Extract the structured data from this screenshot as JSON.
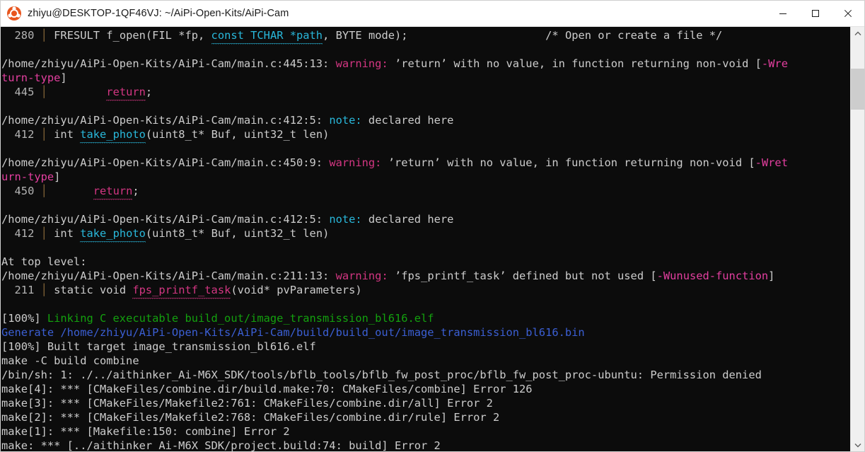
{
  "window": {
    "title": "zhiyu@DESKTOP-1QF46VJ: ~/AiPi-Open-Kits/AiPi-Cam",
    "app_icon": "ubuntu-icon",
    "minimize_label": "—",
    "maximize_label": "□",
    "close_label": "✕"
  },
  "colors": {
    "background": "#0c0c0c",
    "foreground": "#cccccc",
    "magenta": "#d33682",
    "cyan": "#29b8db",
    "green": "#13a10e",
    "blue": "#3b5fd4",
    "gutter": "#8a6a3a",
    "titlebar_bg": "#ffffff",
    "scrollbar_bg": "#f0f0f0",
    "scrollbar_thumb": "#cdcdcd"
  },
  "scrollbar": {
    "up_arrow": "chevron-up-icon",
    "down_arrow": "chevron-down-icon",
    "thumb": "scrollbar-thumb"
  },
  "terminal": {
    "lines": [
      {
        "id": "line-280",
        "segments": [
          {
            "text": "  280 ",
            "color": "dim"
          },
          {
            "text": "│",
            "color": "gutter"
          },
          {
            "text": " FRESULT f_open(FIL *fp, ",
            "color": "def"
          },
          {
            "text": "const TCHAR *path",
            "color": "cyan",
            "squiggle": "cyan"
          },
          {
            "text": ", BYTE mode);",
            "color": "def"
          },
          {
            "text": "                     ",
            "color": "def"
          },
          {
            "text": "/* Open or create a file */",
            "color": "def"
          }
        ]
      },
      {
        "id": "blank-1",
        "segments": []
      },
      {
        "id": "warn-445",
        "segments": [
          {
            "text": "/home/zhiyu/AiPi-Open-Kits/AiPi-Cam/main.c:445:13: ",
            "color": "def"
          },
          {
            "text": "warning: ",
            "color": "mag"
          },
          {
            "text": "’return’ with no value, in function returning non-void [",
            "color": "def"
          },
          {
            "text": "-Wre",
            "color": "magb"
          }
        ]
      },
      {
        "id": "warn-445-wrap",
        "segments": [
          {
            "text": "turn-type",
            "color": "magb"
          },
          {
            "text": "]",
            "color": "def"
          }
        ]
      },
      {
        "id": "line-445",
        "segments": [
          {
            "text": "  445 ",
            "color": "dim"
          },
          {
            "text": "│",
            "color": "gutter"
          },
          {
            "text": "         ",
            "color": "def"
          },
          {
            "text": "return",
            "color": "mag",
            "squiggle": "mag"
          },
          {
            "text": ";",
            "color": "def"
          }
        ]
      },
      {
        "id": "blank-2",
        "segments": []
      },
      {
        "id": "note-412-a",
        "segments": [
          {
            "text": "/home/zhiyu/AiPi-Open-Kits/AiPi-Cam/main.c:412:5: ",
            "color": "def"
          },
          {
            "text": "note: ",
            "color": "cyan"
          },
          {
            "text": "declared here",
            "color": "def"
          }
        ]
      },
      {
        "id": "line-412-a",
        "segments": [
          {
            "text": "  412 ",
            "color": "dim"
          },
          {
            "text": "│",
            "color": "gutter"
          },
          {
            "text": " int ",
            "color": "def"
          },
          {
            "text": "take_photo",
            "color": "cyan",
            "squiggle": "cyan"
          },
          {
            "text": "(uint8_t* Buf, uint32_t len)",
            "color": "def"
          }
        ]
      },
      {
        "id": "blank-3",
        "segments": []
      },
      {
        "id": "warn-450",
        "segments": [
          {
            "text": "/home/zhiyu/AiPi-Open-Kits/AiPi-Cam/main.c:450:9: ",
            "color": "def"
          },
          {
            "text": "warning: ",
            "color": "mag"
          },
          {
            "text": "’return’ with no value, in function returning non-void [",
            "color": "def"
          },
          {
            "text": "-Wret",
            "color": "magb"
          }
        ]
      },
      {
        "id": "warn-450-wrap",
        "segments": [
          {
            "text": "urn-type",
            "color": "magb"
          },
          {
            "text": "]",
            "color": "def"
          }
        ]
      },
      {
        "id": "line-450",
        "segments": [
          {
            "text": "  450 ",
            "color": "dim"
          },
          {
            "text": "│",
            "color": "gutter"
          },
          {
            "text": "       ",
            "color": "def"
          },
          {
            "text": "return",
            "color": "mag",
            "squiggle": "mag"
          },
          {
            "text": ";",
            "color": "def"
          }
        ]
      },
      {
        "id": "blank-4",
        "segments": []
      },
      {
        "id": "note-412-b",
        "segments": [
          {
            "text": "/home/zhiyu/AiPi-Open-Kits/AiPi-Cam/main.c:412:5: ",
            "color": "def"
          },
          {
            "text": "note: ",
            "color": "cyan"
          },
          {
            "text": "declared here",
            "color": "def"
          }
        ]
      },
      {
        "id": "line-412-b",
        "segments": [
          {
            "text": "  412 ",
            "color": "dim"
          },
          {
            "text": "│",
            "color": "gutter"
          },
          {
            "text": " int ",
            "color": "def"
          },
          {
            "text": "take_photo",
            "color": "cyan",
            "squiggle": "cyan"
          },
          {
            "text": "(uint8_t* Buf, uint32_t len)",
            "color": "def"
          }
        ]
      },
      {
        "id": "blank-5",
        "segments": []
      },
      {
        "id": "at-top-level",
        "segments": [
          {
            "text": "At top level:",
            "color": "def"
          }
        ]
      },
      {
        "id": "warn-211",
        "segments": [
          {
            "text": "/home/zhiyu/AiPi-Open-Kits/AiPi-Cam/main.c:211:13: ",
            "color": "def"
          },
          {
            "text": "warning: ",
            "color": "mag"
          },
          {
            "text": "’fps_printf_task’ defined but not used [",
            "color": "def"
          },
          {
            "text": "-Wunused-function",
            "color": "magb"
          },
          {
            "text": "]",
            "color": "def"
          }
        ]
      },
      {
        "id": "line-211",
        "segments": [
          {
            "text": "  211 ",
            "color": "dim"
          },
          {
            "text": "│",
            "color": "gutter"
          },
          {
            "text": " static void ",
            "color": "def"
          },
          {
            "text": "fps_printf_task",
            "color": "mag",
            "squiggle": "mag"
          },
          {
            "text": "(void* pvParameters)",
            "color": "def"
          }
        ]
      },
      {
        "id": "blank-6",
        "segments": []
      },
      {
        "id": "link-100",
        "segments": [
          {
            "text": "[100%] ",
            "color": "def"
          },
          {
            "text": "Linking C executable build_out/image_transmission_bl616.elf",
            "color": "green"
          }
        ]
      },
      {
        "id": "generate-bin",
        "segments": [
          {
            "text": "Generate /home/zhiyu/AiPi-Open-Kits/AiPi-Cam/build/build_out/image_transmission_bl616.bin",
            "color": "blue"
          }
        ]
      },
      {
        "id": "built-target",
        "segments": [
          {
            "text": "[100%] Built target image_transmission_bl616.elf",
            "color": "def"
          }
        ]
      },
      {
        "id": "make-c-build-combine",
        "segments": [
          {
            "text": "make -C build combine",
            "color": "def"
          }
        ]
      },
      {
        "id": "permission-denied",
        "segments": [
          {
            "text": "/bin/sh: 1: ./../aithinker_Ai-M6X_SDK/tools/bflb_tools/bflb_fw_post_proc/bflb_fw_post_proc-ubuntu: Permission denied",
            "color": "def"
          }
        ]
      },
      {
        "id": "make4-error",
        "segments": [
          {
            "text": "make[4]: *** [CMakeFiles/combine.dir/build.make:70: CMakeFiles/combine] Error 126",
            "color": "def"
          }
        ]
      },
      {
        "id": "make3-error",
        "segments": [
          {
            "text": "make[3]: *** [CMakeFiles/Makefile2:761: CMakeFiles/combine.dir/all] Error 2",
            "color": "def"
          }
        ]
      },
      {
        "id": "make2-error",
        "segments": [
          {
            "text": "make[2]: *** [CMakeFiles/Makefile2:768: CMakeFiles/combine.dir/rule] Error 2",
            "color": "def"
          }
        ]
      },
      {
        "id": "make1-error",
        "segments": [
          {
            "text": "make[1]: *** [Makefile:150: combine] Error 2",
            "color": "def"
          }
        ]
      },
      {
        "id": "make-error",
        "segments": [
          {
            "text": "make: *** [../aithinker_Ai-M6X_SDK/project.build:74: build] Error 2",
            "color": "def"
          }
        ]
      }
    ]
  }
}
